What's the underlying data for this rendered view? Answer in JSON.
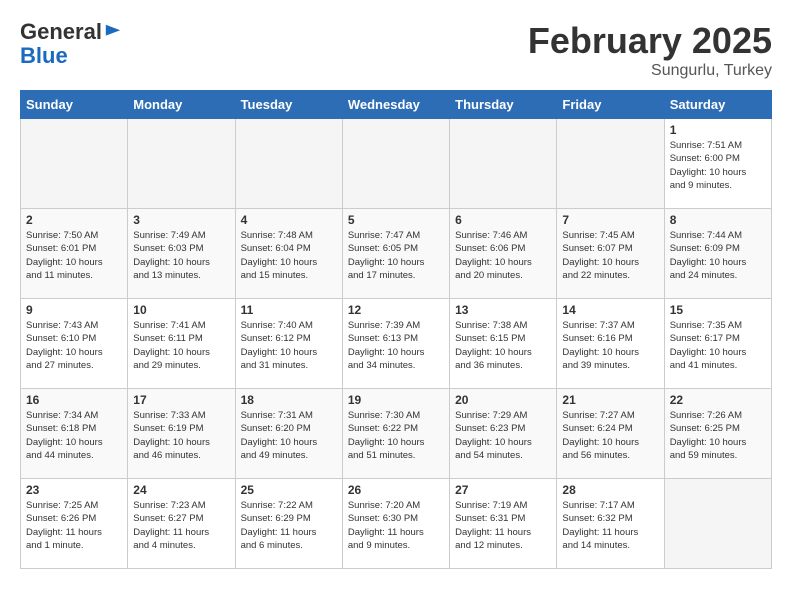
{
  "header": {
    "logo_line1": "General",
    "logo_line2": "Blue",
    "month": "February 2025",
    "location": "Sungurlu, Turkey"
  },
  "weekdays": [
    "Sunday",
    "Monday",
    "Tuesday",
    "Wednesday",
    "Thursday",
    "Friday",
    "Saturday"
  ],
  "weeks": [
    [
      {
        "day": "",
        "info": ""
      },
      {
        "day": "",
        "info": ""
      },
      {
        "day": "",
        "info": ""
      },
      {
        "day": "",
        "info": ""
      },
      {
        "day": "",
        "info": ""
      },
      {
        "day": "",
        "info": ""
      },
      {
        "day": "1",
        "info": "Sunrise: 7:51 AM\nSunset: 6:00 PM\nDaylight: 10 hours\nand 9 minutes."
      }
    ],
    [
      {
        "day": "2",
        "info": "Sunrise: 7:50 AM\nSunset: 6:01 PM\nDaylight: 10 hours\nand 11 minutes."
      },
      {
        "day": "3",
        "info": "Sunrise: 7:49 AM\nSunset: 6:03 PM\nDaylight: 10 hours\nand 13 minutes."
      },
      {
        "day": "4",
        "info": "Sunrise: 7:48 AM\nSunset: 6:04 PM\nDaylight: 10 hours\nand 15 minutes."
      },
      {
        "day": "5",
        "info": "Sunrise: 7:47 AM\nSunset: 6:05 PM\nDaylight: 10 hours\nand 17 minutes."
      },
      {
        "day": "6",
        "info": "Sunrise: 7:46 AM\nSunset: 6:06 PM\nDaylight: 10 hours\nand 20 minutes."
      },
      {
        "day": "7",
        "info": "Sunrise: 7:45 AM\nSunset: 6:07 PM\nDaylight: 10 hours\nand 22 minutes."
      },
      {
        "day": "8",
        "info": "Sunrise: 7:44 AM\nSunset: 6:09 PM\nDaylight: 10 hours\nand 24 minutes."
      }
    ],
    [
      {
        "day": "9",
        "info": "Sunrise: 7:43 AM\nSunset: 6:10 PM\nDaylight: 10 hours\nand 27 minutes."
      },
      {
        "day": "10",
        "info": "Sunrise: 7:41 AM\nSunset: 6:11 PM\nDaylight: 10 hours\nand 29 minutes."
      },
      {
        "day": "11",
        "info": "Sunrise: 7:40 AM\nSunset: 6:12 PM\nDaylight: 10 hours\nand 31 minutes."
      },
      {
        "day": "12",
        "info": "Sunrise: 7:39 AM\nSunset: 6:13 PM\nDaylight: 10 hours\nand 34 minutes."
      },
      {
        "day": "13",
        "info": "Sunrise: 7:38 AM\nSunset: 6:15 PM\nDaylight: 10 hours\nand 36 minutes."
      },
      {
        "day": "14",
        "info": "Sunrise: 7:37 AM\nSunset: 6:16 PM\nDaylight: 10 hours\nand 39 minutes."
      },
      {
        "day": "15",
        "info": "Sunrise: 7:35 AM\nSunset: 6:17 PM\nDaylight: 10 hours\nand 41 minutes."
      }
    ],
    [
      {
        "day": "16",
        "info": "Sunrise: 7:34 AM\nSunset: 6:18 PM\nDaylight: 10 hours\nand 44 minutes."
      },
      {
        "day": "17",
        "info": "Sunrise: 7:33 AM\nSunset: 6:19 PM\nDaylight: 10 hours\nand 46 minutes."
      },
      {
        "day": "18",
        "info": "Sunrise: 7:31 AM\nSunset: 6:20 PM\nDaylight: 10 hours\nand 49 minutes."
      },
      {
        "day": "19",
        "info": "Sunrise: 7:30 AM\nSunset: 6:22 PM\nDaylight: 10 hours\nand 51 minutes."
      },
      {
        "day": "20",
        "info": "Sunrise: 7:29 AM\nSunset: 6:23 PM\nDaylight: 10 hours\nand 54 minutes."
      },
      {
        "day": "21",
        "info": "Sunrise: 7:27 AM\nSunset: 6:24 PM\nDaylight: 10 hours\nand 56 minutes."
      },
      {
        "day": "22",
        "info": "Sunrise: 7:26 AM\nSunset: 6:25 PM\nDaylight: 10 hours\nand 59 minutes."
      }
    ],
    [
      {
        "day": "23",
        "info": "Sunrise: 7:25 AM\nSunset: 6:26 PM\nDaylight: 11 hours\nand 1 minute."
      },
      {
        "day": "24",
        "info": "Sunrise: 7:23 AM\nSunset: 6:27 PM\nDaylight: 11 hours\nand 4 minutes."
      },
      {
        "day": "25",
        "info": "Sunrise: 7:22 AM\nSunset: 6:29 PM\nDaylight: 11 hours\nand 6 minutes."
      },
      {
        "day": "26",
        "info": "Sunrise: 7:20 AM\nSunset: 6:30 PM\nDaylight: 11 hours\nand 9 minutes."
      },
      {
        "day": "27",
        "info": "Sunrise: 7:19 AM\nSunset: 6:31 PM\nDaylight: 11 hours\nand 12 minutes."
      },
      {
        "day": "28",
        "info": "Sunrise: 7:17 AM\nSunset: 6:32 PM\nDaylight: 11 hours\nand 14 minutes."
      },
      {
        "day": "",
        "info": ""
      }
    ]
  ]
}
